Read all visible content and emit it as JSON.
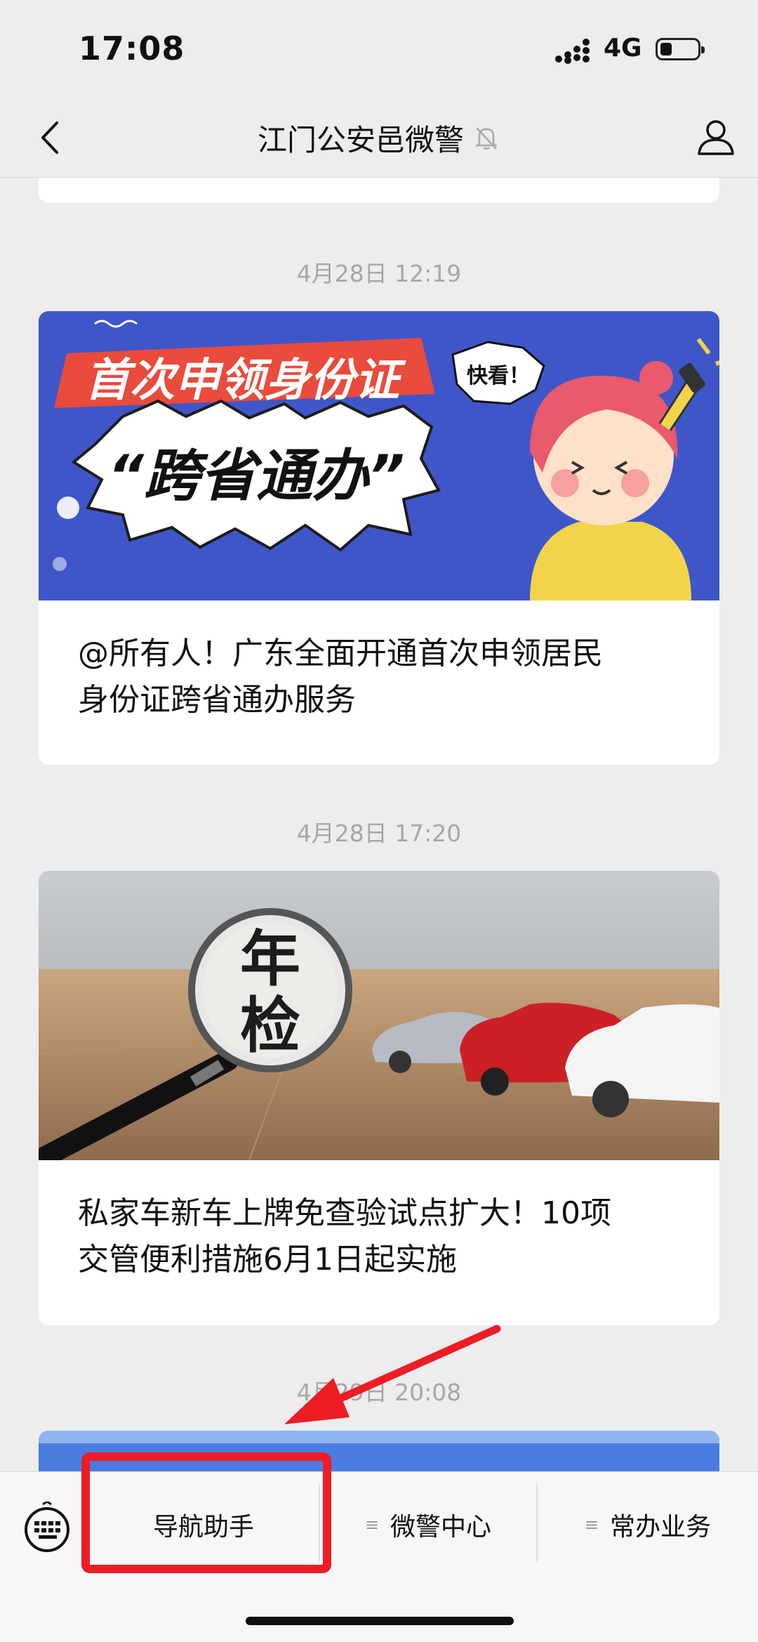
{
  "status_bar": {
    "time": "17:08",
    "network": "4G",
    "battery_icon": "battery-low-icon"
  },
  "nav": {
    "title": "江门公安邑微警",
    "back_icon": "back-chevron-icon",
    "mute_icon": "bell-muted-icon",
    "profile_icon": "person-icon"
  },
  "feed": {
    "messages": [
      {
        "time": "4月28日 12:19",
        "image": {
          "banner_title": "首次申领身份证",
          "burst_text": "“跨省通办”",
          "bubble_text": "快看！"
        },
        "title_lines": [
          "@所有人！广东全面开通首次申领居民",
          "身份证跨省通办服务"
        ]
      },
      {
        "time": "4月28日 17:20",
        "image": {
          "lens_text_top": "年",
          "lens_text_bottom": "检"
        },
        "title_lines": [
          "私家车新车上牌免查验试点扩大！10项",
          "交管便利措施6月1日起实施"
        ]
      },
      {
        "time": "4月29日 20:08"
      }
    ]
  },
  "bottom_menu": {
    "keyboard_icon": "keyboard-icon",
    "items": [
      {
        "label": "导航助手"
      },
      {
        "label": "微警中心"
      },
      {
        "label": "常办业务"
      }
    ]
  },
  "annotation": {
    "highlight_color": "#ee1c25",
    "target": "导航助手"
  },
  "colors": {
    "background": "#ededed",
    "banner_blue": "#3f56c9",
    "banner_red": "#e94b3c",
    "timestamp": "#a7a7a7"
  }
}
